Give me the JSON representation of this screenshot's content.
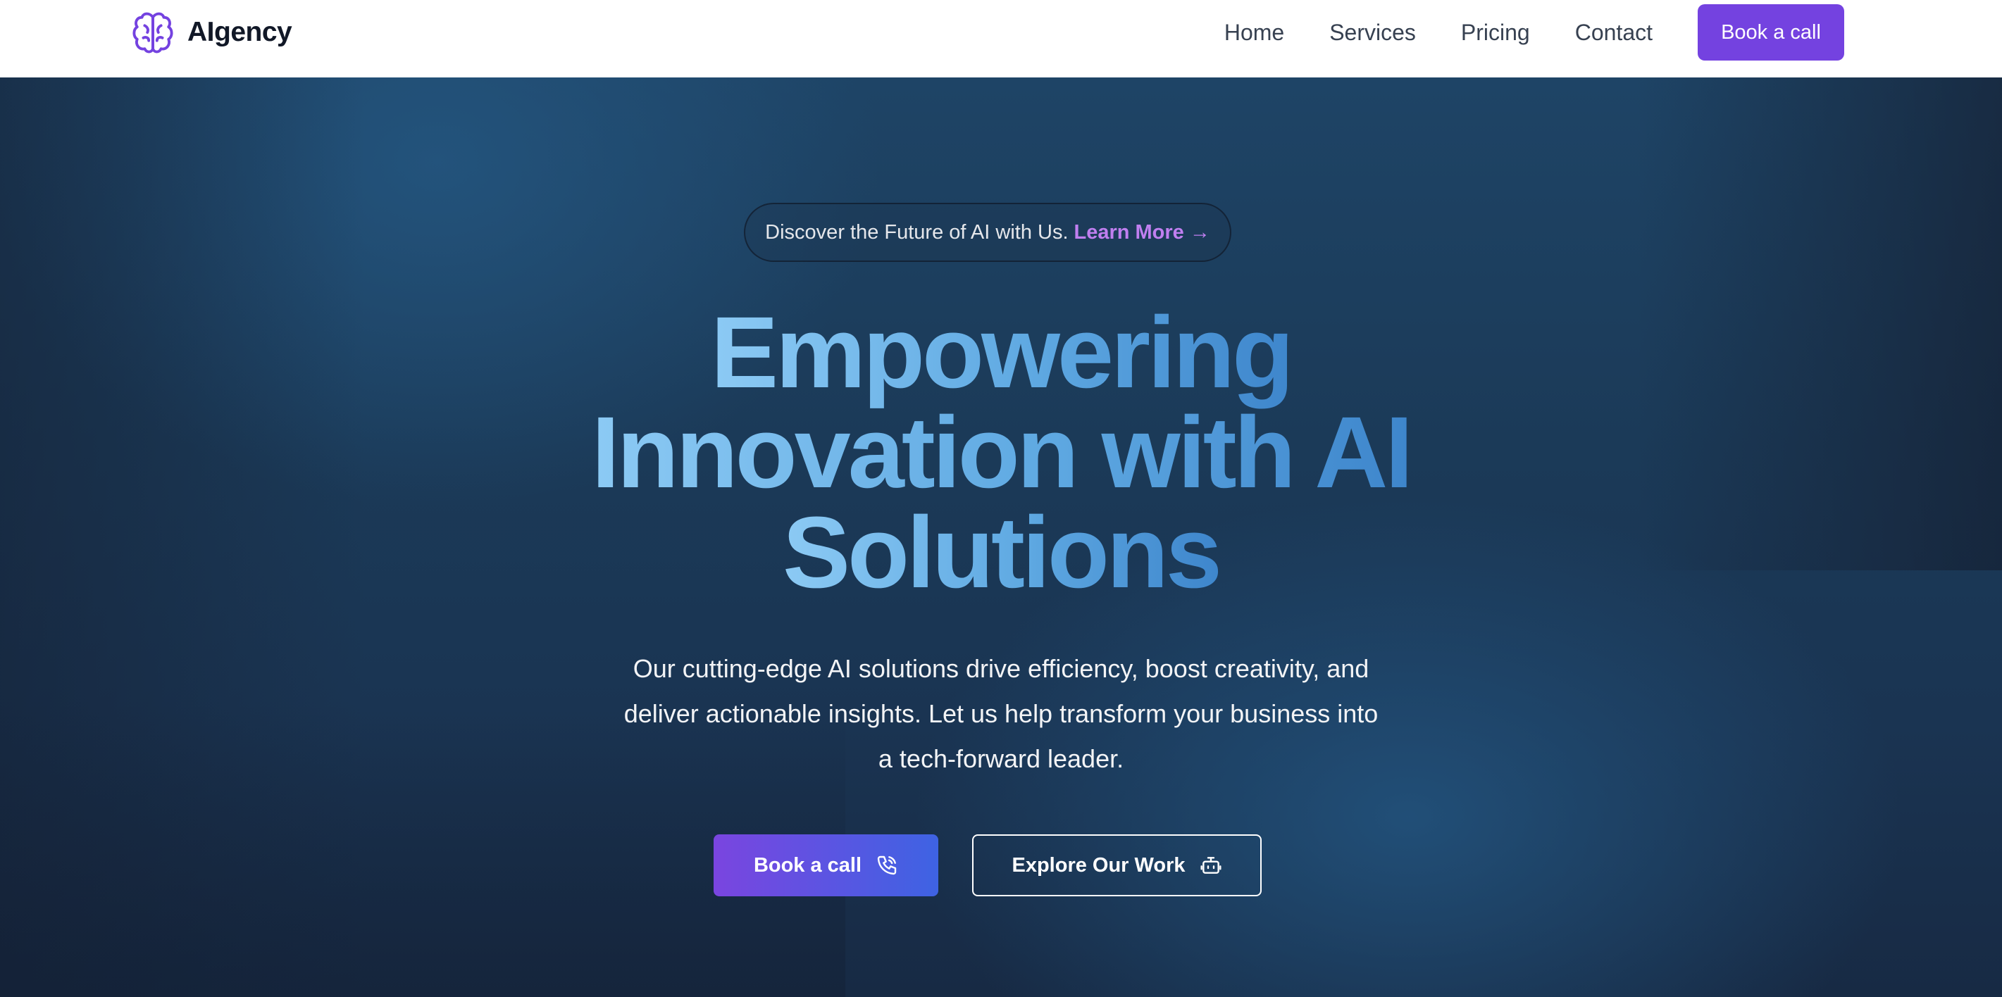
{
  "brand": {
    "name": "AIgency",
    "icon": "brain-icon",
    "accent_color": "#7442e0"
  },
  "nav": {
    "links": [
      "Home",
      "Services",
      "Pricing",
      "Contact"
    ],
    "cta_label": "Book a call"
  },
  "hero": {
    "announcement": {
      "text": "Discover the Future of AI with Us.",
      "link_label": "Learn More",
      "arrow": "→"
    },
    "headline_lines": [
      "Empowering",
      "Innovation with AI",
      "Solutions"
    ],
    "subtitle": "Our cutting-edge AI solutions drive efficiency, boost creativity, and deliver actionable insights. Let us help transform your business into a tech-forward leader.",
    "primary_button": {
      "label": "Book a call",
      "icon": "phone-icon"
    },
    "secondary_button": {
      "label": "Explore Our Work",
      "icon": "robot-icon"
    },
    "colors": {
      "background_dark": "#16243a",
      "background_mid": "#1e4466",
      "headline_gradient_start": "#8ccaf4",
      "headline_gradient_end": "#3e86cc",
      "link_purple": "#c07ff0",
      "primary_gradient_start": "#7a45e0",
      "primary_gradient_end": "#3e63e3"
    }
  }
}
